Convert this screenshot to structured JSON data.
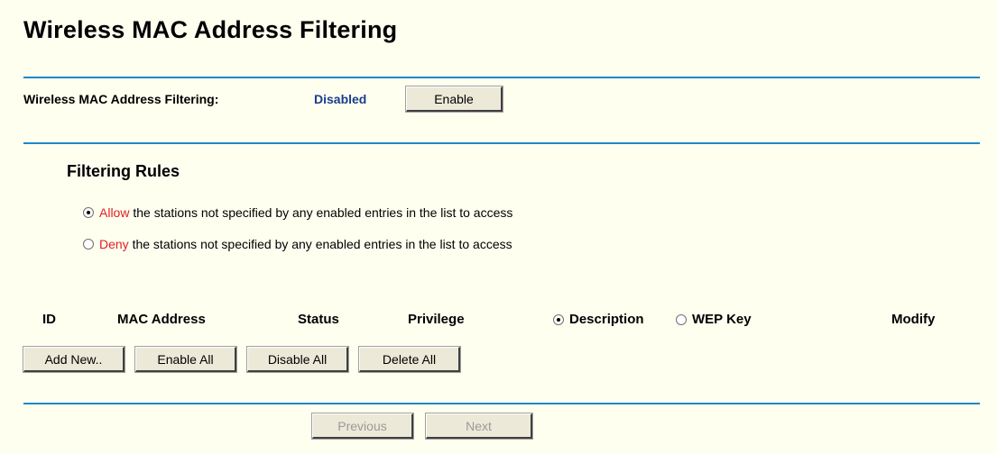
{
  "page_title": "Wireless MAC Address Filtering",
  "filtering": {
    "label": "Wireless MAC Address Filtering:",
    "status": "Disabled",
    "enable_button": "Enable"
  },
  "rules": {
    "title": "Filtering Rules",
    "allow": {
      "keyword": "Allow",
      "text": " the stations not specified by any enabled entries in the list to access",
      "checked": true
    },
    "deny": {
      "keyword": "Deny",
      "text": " the stations not specified by any enabled entries in the list to access",
      "checked": false
    }
  },
  "table": {
    "headers": {
      "id": "ID",
      "mac": "MAC Address",
      "status": "Status",
      "privilege": "Privilege",
      "description": "Description",
      "wep_key": "WEP Key",
      "modify": "Modify"
    },
    "column_mode": "description",
    "rows": []
  },
  "actions": {
    "add_new": "Add New..",
    "enable_all": "Enable All",
    "disable_all": "Disable All",
    "delete_all": "Delete All"
  },
  "pager": {
    "previous": "Previous",
    "next": "Next"
  },
  "colors": {
    "rule_line": "#1e88c8",
    "status_text": "#1a3c8c",
    "highlight_red": "#e02020",
    "background": "#fffff0"
  }
}
